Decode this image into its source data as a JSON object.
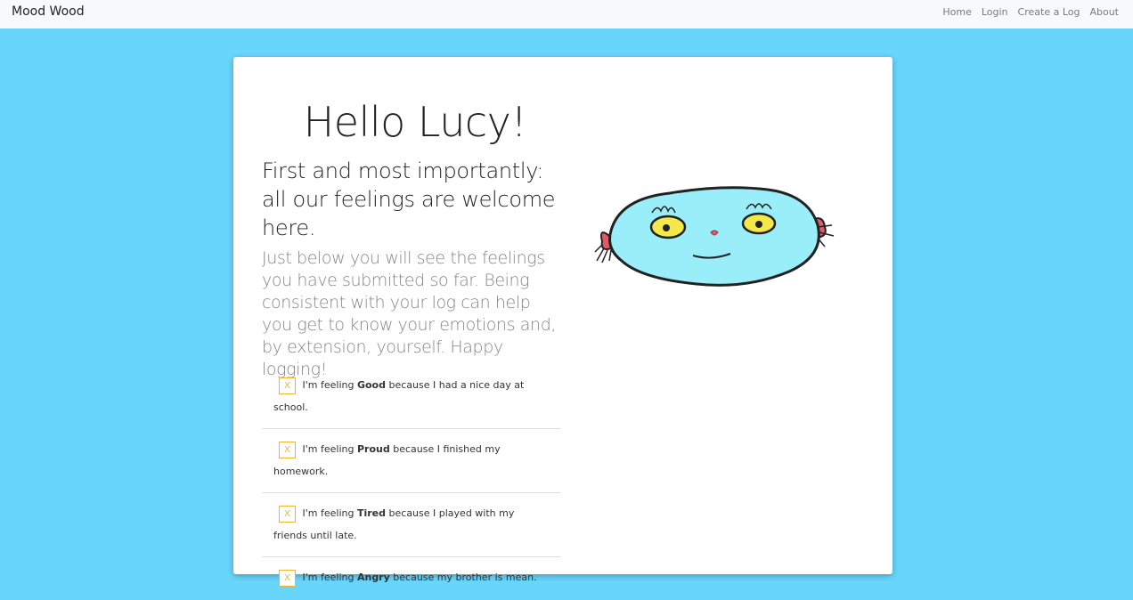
{
  "navbar": {
    "brand": "Mood Wood",
    "links": [
      "Home",
      "Login",
      "Create a Log",
      "About"
    ]
  },
  "main": {
    "greeting": "Hello Lucy!",
    "heading": "First and most importantly: all our feelings are welcome here.",
    "intro": "Just below you will see the feelings you have submitted so far. Being consistent with your log can help you get to know your emotions and, by extension, yourself. Happy logging!",
    "logs": [
      {
        "delete_label": "X",
        "prefix": "I'm feeling",
        "mood": "Good",
        "reason": "because I had a nice day at school."
      },
      {
        "delete_label": "X",
        "prefix": "I'm feeling",
        "mood": "Proud",
        "reason": "because I finished my homework."
      },
      {
        "delete_label": "X",
        "prefix": "I'm feeling",
        "mood": "Tired",
        "reason": "because I played with my friends until late."
      },
      {
        "delete_label": "X",
        "prefix": "I'm feeling",
        "mood": "Angry",
        "reason": "because my brother is mean."
      }
    ]
  },
  "colors": {
    "background": "#68d5fb",
    "navbar": "#f8f9fa",
    "delete_accent": "#f0b429",
    "mascot_body": "#9aeef9"
  },
  "icons": {
    "mascot": "blue-creature-drawing"
  }
}
